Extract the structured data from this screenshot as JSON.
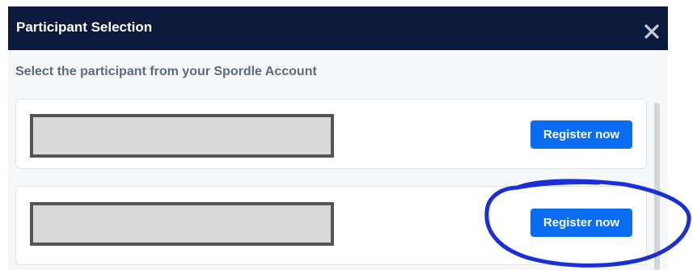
{
  "modal": {
    "title": "Participant Selection",
    "subtitle": "Select the participant from your Spordle Account",
    "close_icon": "close-icon"
  },
  "participants": [
    {
      "name_redacted": true,
      "register_label": "Register now"
    },
    {
      "name_redacted": true,
      "register_label": "Register now"
    }
  ],
  "colors": {
    "header_bg": "#0b1a3d",
    "button_bg": "#0a6cf0",
    "annotation": "#1a2fd8"
  }
}
